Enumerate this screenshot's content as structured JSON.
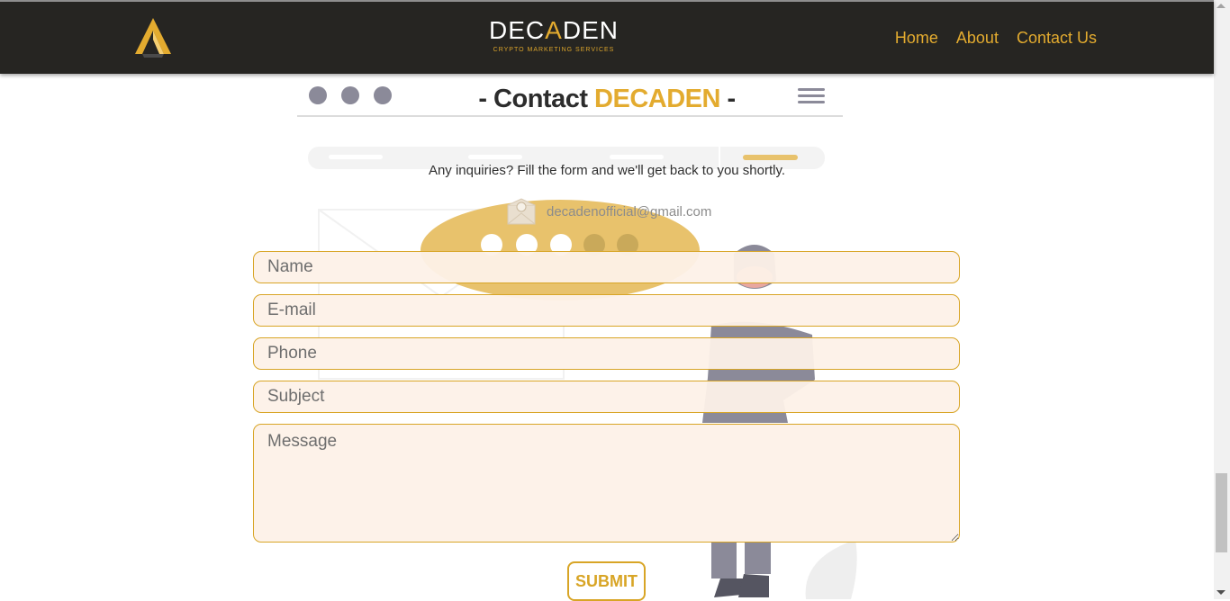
{
  "header": {
    "brand_name_pre": "DEC",
    "brand_name_a": "A",
    "brand_name_post": "DEN",
    "brand_tagline": "CRYPTO MARKETING SERVICES",
    "nav": [
      {
        "label": "Home"
      },
      {
        "label": "About"
      },
      {
        "label": "Contact Us"
      }
    ]
  },
  "contact": {
    "title_prefix": "- Contact ",
    "title_highlight": "DECADEN",
    "title_suffix": " -",
    "subtitle": "Any inquiries? Fill the form and we'll get back to you shortly.",
    "email": "decadenofficial@gmail.com"
  },
  "form": {
    "name_placeholder": "Name",
    "email_placeholder": "E-mail",
    "phone_placeholder": "Phone",
    "subject_placeholder": "Subject",
    "message_placeholder": "Message",
    "submit_label": "SUBMIT"
  },
  "colors": {
    "header_bg": "#262522",
    "accent": "#e3ab2f",
    "field_bg": "#fdf1e8"
  },
  "icons": [
    "decaden-logo-icon",
    "mail-icon",
    "hamburger-icon"
  ]
}
